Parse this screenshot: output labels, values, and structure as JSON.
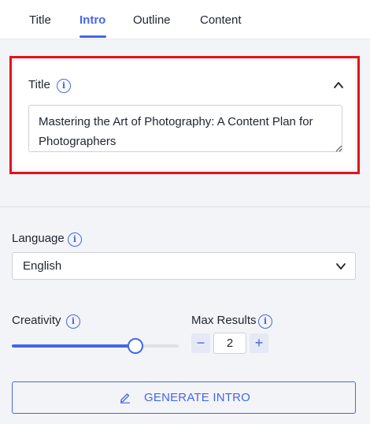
{
  "tabs": [
    {
      "label": "Title"
    },
    {
      "label": "Intro"
    },
    {
      "label": "Outline"
    },
    {
      "label": "Content"
    }
  ],
  "active_tab": "Intro",
  "title_section": {
    "label": "Title",
    "value": "Mastering the Art of Photography: A Content Plan for Photographers"
  },
  "language": {
    "label": "Language",
    "selected": "English"
  },
  "creativity": {
    "label": "Creativity",
    "level": 0.74
  },
  "max_results": {
    "label": "Max Results",
    "value": "2",
    "minus": "−",
    "plus": "+"
  },
  "generate_button": {
    "label": "GENERATE INTRO",
    "icon": "pencil-icon"
  },
  "colors": {
    "accent": "#4466e8",
    "highlight_border": "#e3131b"
  }
}
